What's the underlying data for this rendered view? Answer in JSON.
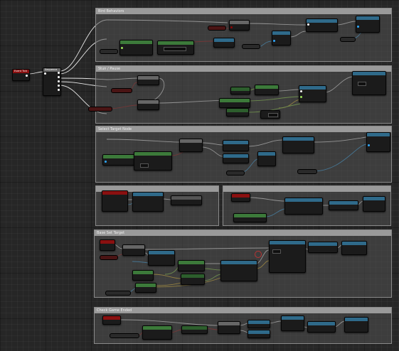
{
  "comments": [
    {
      "key": "c1",
      "title": "Bird Behaviors"
    },
    {
      "key": "c2",
      "title": "Stun / Pause"
    },
    {
      "key": "c3",
      "title": "Select Target Node"
    },
    {
      "key": "c4",
      "title": ""
    },
    {
      "key": "c5",
      "title": ""
    },
    {
      "key": "c6",
      "title": "Base Set Target"
    },
    {
      "key": "c7",
      "title": "Check Game Ended"
    }
  ],
  "nodes": {
    "event_node": {
      "title": "Event Tick"
    },
    "sequence_node": {
      "title": "Sequence"
    }
  },
  "node_types": [
    "event",
    "function",
    "pure",
    "math",
    "branch",
    "cast",
    "variable",
    "macro"
  ],
  "colors": {
    "event": "#8a1010",
    "function": "#2f6a8a",
    "pure": "#3c7a3a",
    "math": "#2d5e2d",
    "branch": "#666666",
    "exec": "#ffffff",
    "bool": "#8b0000",
    "float": "#9be15a",
    "vector": "#f0c040",
    "object": "#2fa8ff",
    "struct": "#1f4c8a",
    "wire_exec": "#e6e6e6",
    "wire_bool": "#9a1a1a",
    "wire_float": "#8fd04a",
    "wire_vector": "#e0b830",
    "wire_object": "#3aa0e0"
  }
}
